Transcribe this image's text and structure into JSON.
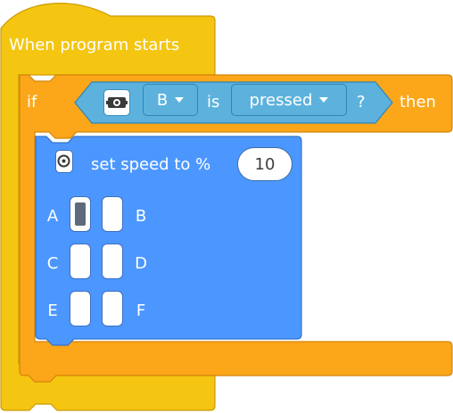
{
  "hat_block": {
    "title": "When program starts"
  },
  "if_block": {
    "if_label": "if",
    "then_label": "then",
    "condition": {
      "icon": "force-sensor-icon",
      "port": "B",
      "is_label": "is",
      "state": "pressed",
      "question_mark": "?"
    }
  },
  "speed_block": {
    "icon": "motor-pair-icon",
    "label": "set speed to %",
    "value": "10",
    "ports": [
      {
        "letter": "A",
        "selected": true
      },
      {
        "letter": "B",
        "selected": false
      },
      {
        "letter": "C",
        "selected": false
      },
      {
        "letter": "D",
        "selected": false
      },
      {
        "letter": "E",
        "selected": false
      },
      {
        "letter": "F",
        "selected": false
      }
    ]
  },
  "colors": {
    "events_yellow": "#f4c612",
    "control_orange": "#fca619",
    "sensor_blue": "#5cb2dc",
    "motor_blue": "#4c97ff"
  }
}
